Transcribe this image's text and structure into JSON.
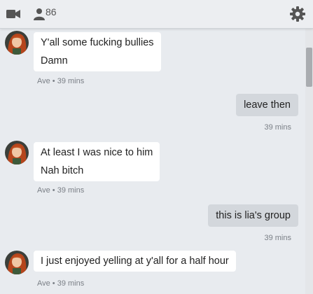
{
  "header": {
    "participant_count": "86",
    "icons": [
      "video-camera-icon",
      "user-icon",
      "gear-icon"
    ]
  },
  "messages": [
    {
      "direction": "incoming",
      "lines": [
        "Y'all some fucking bullies",
        "Damn"
      ],
      "meta": "Ave • 39 mins"
    },
    {
      "direction": "outgoing",
      "lines": [
        "leave then"
      ],
      "meta": "39 mins"
    },
    {
      "direction": "incoming",
      "lines": [
        "At least I was nice to him",
        "Nah bitch"
      ],
      "meta": "Ave • 39 mins"
    },
    {
      "direction": "outgoing",
      "lines": [
        "this is lia's group"
      ],
      "meta": "39 mins"
    },
    {
      "direction": "incoming",
      "lines": [
        "I just enjoyed yelling at y'all for a half hour"
      ],
      "meta": "Ave • 39 mins"
    }
  ]
}
